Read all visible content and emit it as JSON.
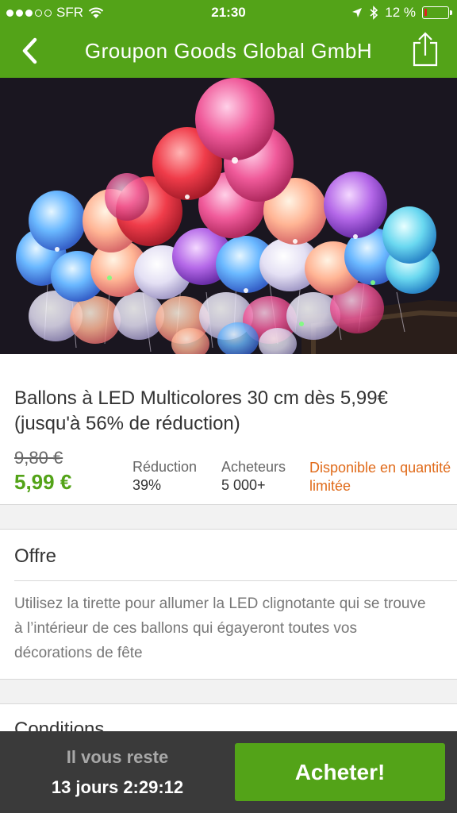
{
  "status_bar": {
    "carrier": "SFR",
    "time": "21:30",
    "battery": "12 %",
    "battery_level": 0.12,
    "battery_color": "#e02020"
  },
  "nav": {
    "title": "Groupon Goods Global GmbH",
    "back_icon": "chevron-left-icon",
    "share_icon": "share-icon"
  },
  "deal": {
    "title": "Ballons à LED Multicolores 30 cm dès 5,99€ (jusqu'à 56% de réduction)",
    "old_price": "9,80 €",
    "new_price": "5,99 €",
    "reduction_label": "Réduction",
    "reduction_value": "39%",
    "buyers_label": "Acheteurs",
    "buyers_value": "5 000+",
    "availability": "Disponible en quantité limitée"
  },
  "offer": {
    "heading": "Offre",
    "text": "Utilisez la tirette pour allumer la LED clignotante qui se trouve à l’intérieur de ces ballons qui égayeront toutes vos décorations de fête"
  },
  "conditions": {
    "heading": "Conditions"
  },
  "bottom_bar": {
    "remaining_label": "Il vous reste",
    "countdown": "13 jours 2:29:12",
    "buy_label": "Acheter!"
  },
  "colors": {
    "brand_green": "#53a318",
    "availability_orange": "#e06a19",
    "bottom_bar": "#3a3a3a"
  }
}
